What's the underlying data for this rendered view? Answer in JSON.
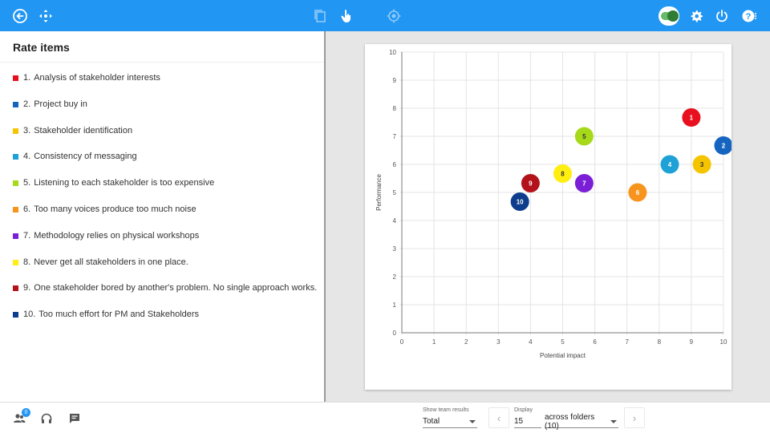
{
  "topbar": {
    "back_icon": "arrow-left-circle-icon",
    "move_icon": "move-arrows-icon",
    "copy_icon": "copy-icon",
    "pointer_icon": "hand-pointer-icon",
    "target_icon": "target-icon",
    "toggle_state": "on",
    "settings_icon": "gear-icon",
    "power_icon": "power-icon",
    "help_icon": "help-icon"
  },
  "left_panel": {
    "title": "Rate items",
    "items": [
      {
        "number": "1.",
        "label": "Analysis of stakeholder interests",
        "color": "#e8101e"
      },
      {
        "number": "2.",
        "label": "Project buy in",
        "color": "#1565c0"
      },
      {
        "number": "3.",
        "label": "Stakeholder identification",
        "color": "#f5c400"
      },
      {
        "number": "4.",
        "label": "Consistency of messaging",
        "color": "#1da1d6"
      },
      {
        "number": "5.",
        "label": "Listening to each stakeholder is too expensive",
        "color": "#a6d91a"
      },
      {
        "number": "6.",
        "label": "Too many voices produce too much noise",
        "color": "#f7941d"
      },
      {
        "number": "7.",
        "label": "Methodology relies on physical workshops",
        "color": "#7a1fd6"
      },
      {
        "number": "8.",
        "label": "Never get all stakeholders in one place.",
        "color": "#ffee10"
      },
      {
        "number": "9.",
        "label": "One stakeholder bored by another's problem. No single approach works.",
        "color": "#b3121b"
      },
      {
        "number": "10.",
        "label": "Too much effort for PM and Stakeholders",
        "color": "#0d3d8c"
      }
    ]
  },
  "chart_data": {
    "type": "scatter",
    "xlabel": "Potential impact",
    "ylabel": "Performance",
    "xlim": [
      0,
      10
    ],
    "ylim": [
      0,
      10
    ],
    "xticks": [
      "0",
      "1",
      "2",
      "3",
      "4",
      "5",
      "6",
      "7",
      "8",
      "9",
      "10"
    ],
    "yticks": [
      "0",
      "1",
      "2",
      "3",
      "4",
      "5",
      "6",
      "7",
      "8",
      "9",
      "10"
    ],
    "grid": true,
    "points": [
      {
        "label": "1",
        "x": 9.0,
        "y": 7.67,
        "color": "#e8101e",
        "text_color": "#ffffff"
      },
      {
        "label": "2",
        "x": 10.0,
        "y": 6.67,
        "color": "#1565c0",
        "text_color": "#ffffff"
      },
      {
        "label": "3",
        "x": 9.33,
        "y": 6.0,
        "color": "#f5c400",
        "text_color": "#333333"
      },
      {
        "label": "4",
        "x": 8.33,
        "y": 6.0,
        "color": "#1da1d6",
        "text_color": "#ffffff"
      },
      {
        "label": "5",
        "x": 5.67,
        "y": 7.0,
        "color": "#a6d91a",
        "text_color": "#333333"
      },
      {
        "label": "6",
        "x": 7.33,
        "y": 5.0,
        "color": "#f7941d",
        "text_color": "#ffffff"
      },
      {
        "label": "7",
        "x": 5.67,
        "y": 5.33,
        "color": "#7a1fd6",
        "text_color": "#ffffff"
      },
      {
        "label": "8",
        "x": 5.0,
        "y": 5.67,
        "color": "#ffee10",
        "text_color": "#333333"
      },
      {
        "label": "9",
        "x": 4.0,
        "y": 5.33,
        "color": "#b3121b",
        "text_color": "#ffffff"
      },
      {
        "label": "10",
        "x": 3.67,
        "y": 4.67,
        "color": "#0d3d8c",
        "text_color": "#ffffff"
      }
    ]
  },
  "bottombar": {
    "team_icon": "team-icon",
    "team_badge": "0",
    "headset_icon": "headset-icon",
    "chat_icon": "chat-icon",
    "show_team_label": "Show team results",
    "show_team_value": "Total",
    "display_label": "Display",
    "display_value": "15",
    "folders_value": "across folders (10)",
    "prev_icon": "chevron-left-icon",
    "next_icon": "chevron-right-icon"
  }
}
